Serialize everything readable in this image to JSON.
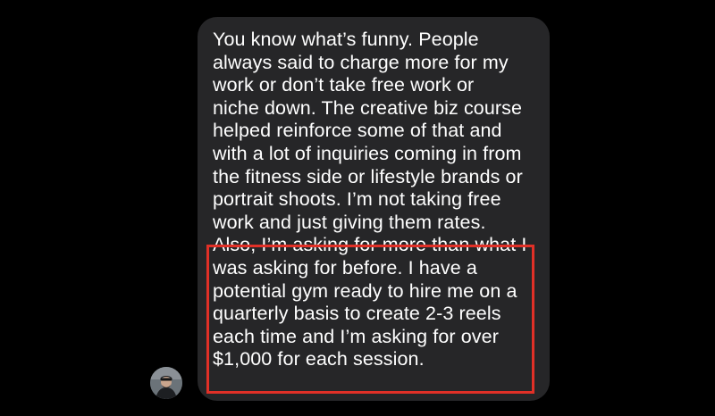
{
  "conversation": {
    "message": {
      "sender": "incoming",
      "lines": [
        "You know what’s funny. People",
        "always said to charge more for my",
        "work or don’t take free work or",
        "niche down. The creative biz course",
        "helped reinforce some of that and",
        "with a lot of inquiries coming in from",
        "the fitness side or lifestyle brands or",
        "portrait shoots. I’m not taking free",
        "work and just giving them rates.",
        "Also, I’m asking for more than what I",
        "was asking for before. I have a",
        "potential gym ready to hire me on a",
        "quarterly basis to create 2-3 reels",
        "each time and I’m asking for over",
        "$1,000 for each session."
      ]
    },
    "avatar_icon": "user-avatar-photo"
  },
  "colors": {
    "background": "#000000",
    "bubble": "#262628",
    "text": "#ffffff",
    "highlight_border": "#e13027"
  }
}
